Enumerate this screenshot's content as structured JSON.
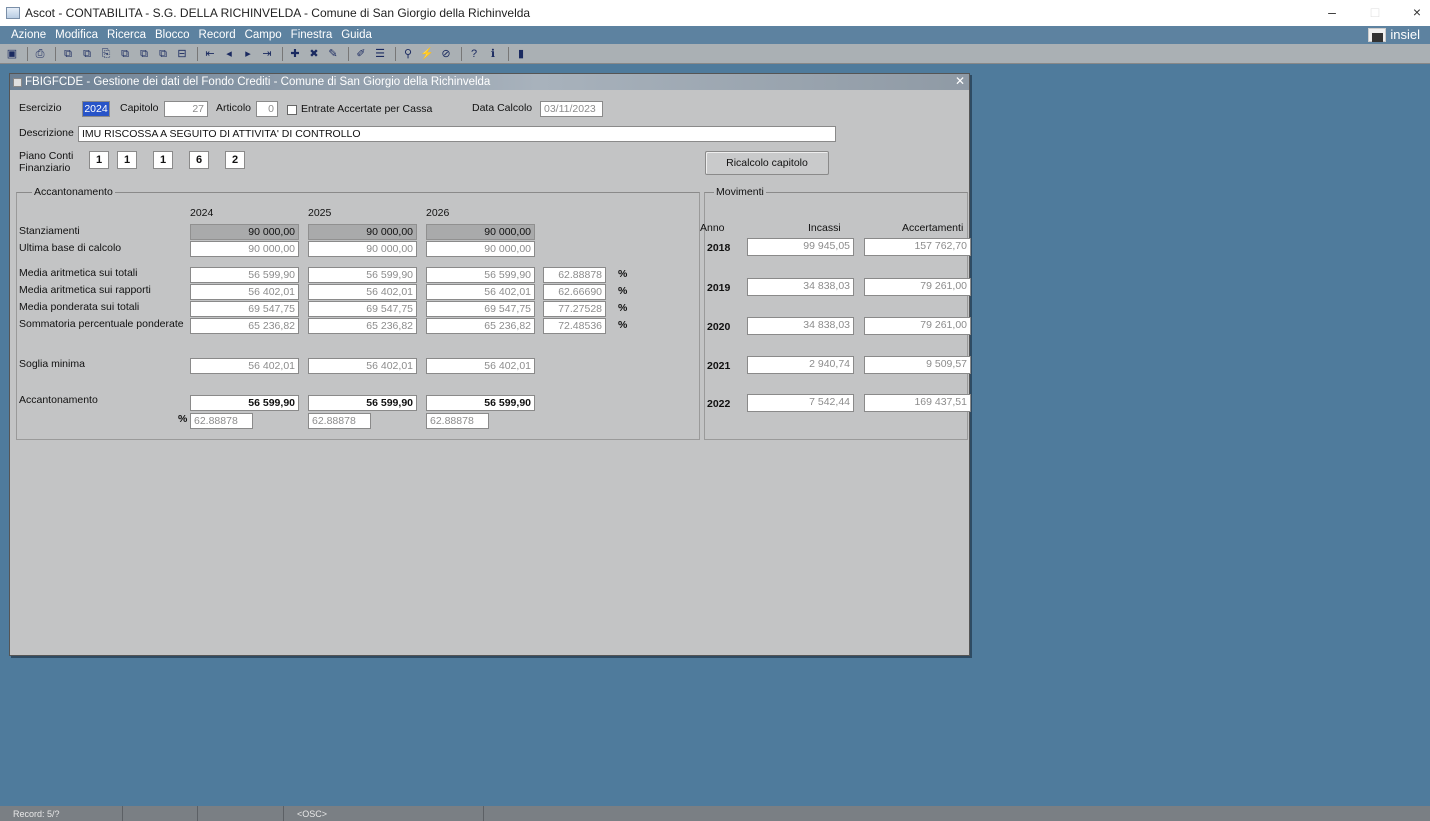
{
  "os_title": "Ascot - CONTABILITA - S.G. DELLA RICHINVELDA - Comune di San Giorgio della Richinvelda",
  "window_controls": {
    "minimize": "–",
    "maximize": "□",
    "close": "×"
  },
  "menu": [
    "Azione",
    "Modifica",
    "Ricerca",
    "Blocco",
    "Record",
    "Campo",
    "Finestra",
    "Guida"
  ],
  "brand": "insiel",
  "toolbar_icons": [
    "save-icon",
    "print-icon",
    "copy-icon",
    "copy-field-icon",
    "paste-icon",
    "duplicate-icon",
    "duplicate-record-icon",
    "clear-icon",
    "first-record-icon",
    "prev-record-icon",
    "next-record-icon",
    "last-record-icon",
    "insert-record-icon",
    "delete-record-icon",
    "lock-record-icon",
    "edit-icon",
    "list-icon",
    "query-icon",
    "execute-query-icon",
    "cancel-query-icon",
    "help-icon",
    "info-icon",
    "exit-icon"
  ],
  "form": {
    "title": "FBIGFCDE - Gestione dei dati del Fondo Crediti - Comune di San Giorgio della Richinvelda",
    "esercizio_label": "Esercizio",
    "esercizio_value": "2024",
    "capitolo_label": "Capitolo",
    "capitolo_value": "27",
    "articolo_label": "Articolo",
    "articolo_value": "0",
    "entrate_label": "Entrate Accertate per Cassa",
    "data_calcolo_label": "Data Calcolo",
    "data_calcolo_value": "03/11/2023",
    "descrizione_label": "Descrizione",
    "descrizione_value": "IMU RISCOSSA A SEGUITO DI ATTIVITA' DI CONTROLLO",
    "piano_conti_label_1": "Piano Conti",
    "piano_conti_label_2": "Finanziario",
    "piano_conti": [
      "1",
      "1",
      "1",
      "6",
      "2"
    ],
    "ricalcolo_button": "Ricalcolo capitolo"
  },
  "accantonamento": {
    "group_label": "Accantonamento",
    "years": [
      "2024",
      "2025",
      "2026"
    ],
    "rows": {
      "stanziamenti": {
        "label": "Stanziamenti",
        "values": [
          "90 000,00",
          "90 000,00",
          "90 000,00"
        ]
      },
      "ultima_base": {
        "label": "Ultima base di calcolo",
        "values": [
          "90 000,00",
          "90 000,00",
          "90 000,00"
        ]
      },
      "media_totali": {
        "label": "Media aritmetica sui totali",
        "values": [
          "56 599,90",
          "56 599,90",
          "56 599,90"
        ],
        "perc": "62.88878"
      },
      "media_rapporti": {
        "label": "Media aritmetica sui rapporti",
        "values": [
          "56 402,01",
          "56 402,01",
          "56 402,01"
        ],
        "perc": "62.66690"
      },
      "media_ponderata": {
        "label": "Media ponderata sui totali",
        "values": [
          "69 547,75",
          "69 547,75",
          "69 547,75"
        ],
        "perc": "77.27528"
      },
      "sommatoria": {
        "label": "Sommatoria percentuale ponderate",
        "values": [
          "65 236,82",
          "65 236,82",
          "65 236,82"
        ],
        "perc": "72.48536"
      },
      "soglia": {
        "label": "Soglia minima",
        "values": [
          "56 402,01",
          "56 402,01",
          "56 402,01"
        ]
      },
      "accantonamento": {
        "label": "Accantonamento",
        "values": [
          "56 599,90",
          "56 599,90",
          "56 599,90"
        ]
      },
      "percentuali": {
        "label": "%",
        "values": [
          "62.88878",
          "62.88878",
          "62.88878"
        ]
      }
    },
    "percent_sign": "%"
  },
  "movimenti": {
    "group_label": "Movimenti",
    "headers": {
      "anno": "Anno",
      "incassi": "Incassi",
      "accertamenti": "Accertamenti"
    },
    "rows": [
      {
        "anno": "2018",
        "incassi": "99 945,05",
        "accertamenti": "157 762,70"
      },
      {
        "anno": "2019",
        "incassi": "34 838,03",
        "accertamenti": "79 261,00"
      },
      {
        "anno": "2020",
        "incassi": "34 838,03",
        "accertamenti": "79 261,00"
      },
      {
        "anno": "2021",
        "incassi": "2 940,74",
        "accertamenti": "9 509,57"
      },
      {
        "anno": "2022",
        "incassi": "7 542,44",
        "accertamenti": "169 437,51"
      }
    ]
  },
  "status": {
    "record": "Record: 5/?",
    "osc": "<OSC>"
  }
}
